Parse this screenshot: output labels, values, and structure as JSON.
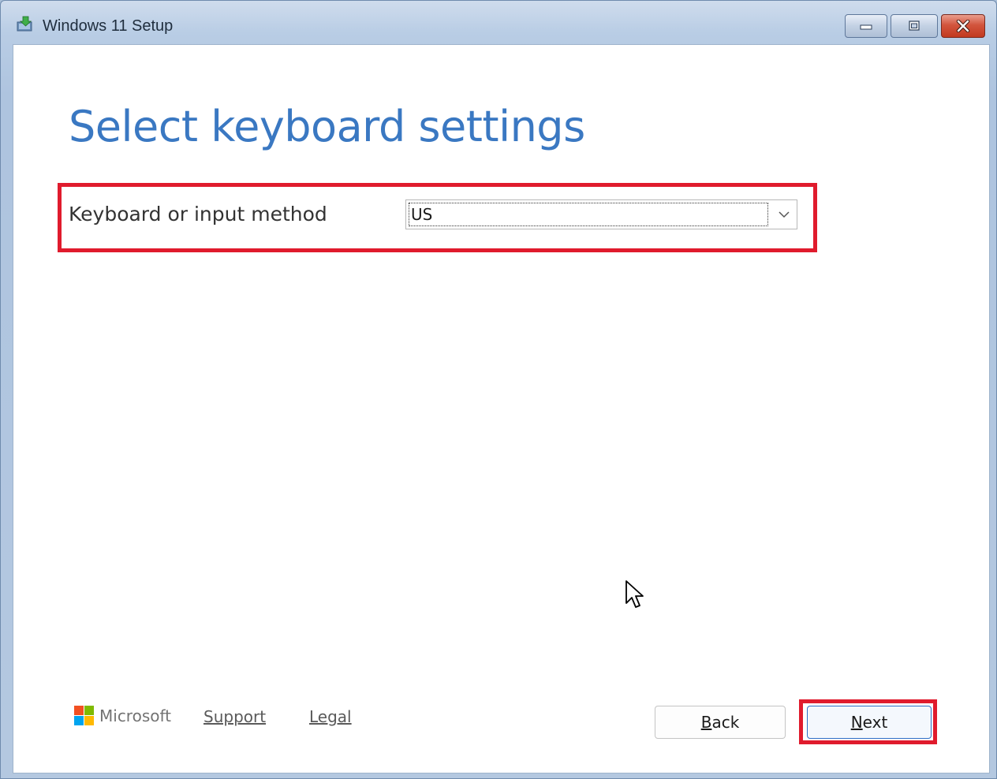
{
  "window": {
    "title": "Windows 11 Setup",
    "icon": "setup-icon",
    "controls": {
      "minimize": "minimize-icon",
      "maximize": "maximize-icon",
      "close": "close-icon"
    }
  },
  "page": {
    "heading": "Select keyboard settings",
    "field_label": "Keyboard or input method",
    "dropdown_value": "US"
  },
  "footer": {
    "brand": "Microsoft",
    "support_link": "Support",
    "legal_link": "Legal",
    "back_button": {
      "prefix": "",
      "accel": "B",
      "rest": "ack"
    },
    "next_button": {
      "prefix": "",
      "accel": "N",
      "rest": "ext"
    }
  },
  "colors": {
    "heading": "#3a78c2",
    "highlight": "#e01b2d",
    "ms_red": "#f25022",
    "ms_green": "#7fba00",
    "ms_blue": "#00a4ef",
    "ms_yellow": "#ffb900"
  }
}
